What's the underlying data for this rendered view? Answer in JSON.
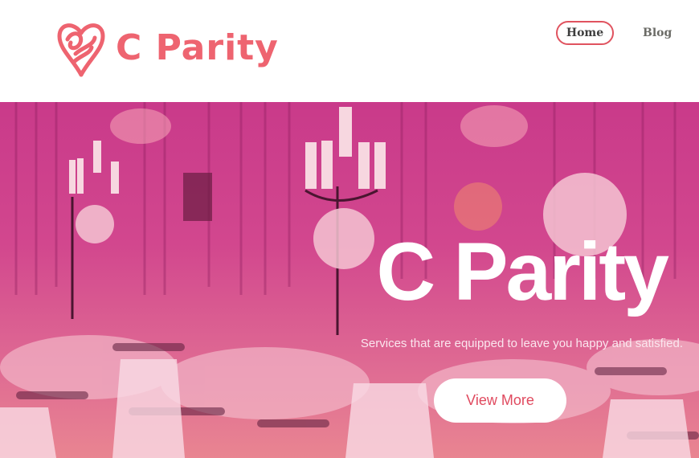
{
  "brand": {
    "name": "C Parity",
    "logo_icon": "heart-swirl-logo-icon",
    "color": "#ee6470"
  },
  "nav": {
    "items": [
      {
        "label": "Home",
        "active": true
      },
      {
        "label": "Blog",
        "active": false
      }
    ]
  },
  "hero": {
    "title": "C Parity",
    "subtitle": "Services that are equipped to leave you happy and satisfied.",
    "cta_label": "View More",
    "overlay_color": "#d2478e"
  }
}
